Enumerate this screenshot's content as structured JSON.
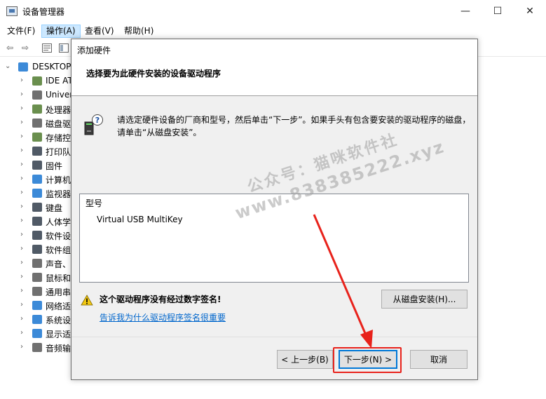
{
  "window": {
    "title": "设备管理器",
    "minimize": "—",
    "maximize": "☐",
    "close": "✕"
  },
  "menu": {
    "items": [
      "文件(F)",
      "操作(A)",
      "查看(V)",
      "帮助(H)"
    ],
    "active_index": 1
  },
  "toolbar": {
    "back": "⇦",
    "forward": "⇨"
  },
  "tree": {
    "root": "DESKTOP",
    "items": [
      {
        "label": "IDE AT",
        "icon": "ide-controller-icon",
        "color": "#6a8f4e"
      },
      {
        "label": "Univer",
        "icon": "usb-icon",
        "color": "#707070"
      },
      {
        "label": "处理器",
        "icon": "processor-icon",
        "color": "#6a8f4e"
      },
      {
        "label": "磁盘驱",
        "icon": "disk-drive-icon",
        "color": "#707070"
      },
      {
        "label": "存储控",
        "icon": "storage-controller-icon",
        "color": "#6a8f4e"
      },
      {
        "label": "打印队",
        "icon": "printer-icon",
        "color": "#505a66"
      },
      {
        "label": "固件",
        "icon": "firmware-icon",
        "color": "#505a66"
      },
      {
        "label": "计算机",
        "icon": "computer-icon",
        "color": "#3c8ad8"
      },
      {
        "label": "监视器",
        "icon": "monitor-icon",
        "color": "#3c8ad8"
      },
      {
        "label": "键盘",
        "icon": "keyboard-icon",
        "color": "#505a66"
      },
      {
        "label": "人体学",
        "icon": "hid-icon",
        "color": "#505a66"
      },
      {
        "label": "软件设",
        "icon": "software-device-icon",
        "color": "#505a66"
      },
      {
        "label": "软件组",
        "icon": "software-component-icon",
        "color": "#505a66"
      },
      {
        "label": "声音、",
        "icon": "sound-icon",
        "color": "#707070"
      },
      {
        "label": "鼠标和",
        "icon": "mouse-icon",
        "color": "#707070"
      },
      {
        "label": "通用串",
        "icon": "usb-controller-icon",
        "color": "#707070"
      },
      {
        "label": "网络适",
        "icon": "network-adapter-icon",
        "color": "#3c8ad8"
      },
      {
        "label": "系统设",
        "icon": "system-device-icon",
        "color": "#3c8ad8"
      },
      {
        "label": "显示适",
        "icon": "display-adapter-icon",
        "color": "#3c8ad8"
      },
      {
        "label": "音频输",
        "icon": "audio-io-icon",
        "color": "#707070"
      }
    ]
  },
  "dialog": {
    "title": "添加硬件",
    "header": "选择要为此硬件安装的设备驱动程序",
    "instructions": "请选定硬件设备的厂商和型号，然后单击“下一步”。如果手头有包含要安装的驱动程序的磁盘，请单击“从磁盘安装”。",
    "model_header": "型号",
    "models": [
      "Virtual USB MultiKey"
    ],
    "warning": "这个驱动程序没有经过数字签名!",
    "warning_link": "告诉我为什么驱动程序签名很重要",
    "have_disk_button": "从磁盘安装(H)...",
    "back_button": "< 上一步(B)",
    "next_button": "下一步(N) >",
    "cancel_button": "取消"
  },
  "watermark": {
    "line1": "公众号：猫咪软件社",
    "line2": "www.838385222.xyz"
  },
  "colors": {
    "accent": "#0078d7",
    "annotation": "#e8221b",
    "link": "#0066cc",
    "menu_active": "#cce8ff"
  }
}
